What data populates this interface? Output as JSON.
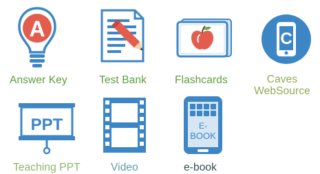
{
  "colors": {
    "icon_blue": "#3d86c6",
    "icon_blue_light": "#d6e6f3",
    "accent_red": "#e35d4f",
    "label_green": "#5f9c3e",
    "label_olive": "#8eab55",
    "label_teal": "#5d9fa6",
    "label_light_green": "#8ab46a",
    "label_dark": "#2f4f4f"
  },
  "resources": [
    {
      "label": "Answer Key",
      "icon": "lightbulb-a-icon",
      "icon_letter": "A"
    },
    {
      "label": "Test Bank",
      "icon": "document-pencil-icon"
    },
    {
      "label": "Flashcards",
      "icon": "apple-flashcard-icon"
    },
    {
      "label_line1": "Caves",
      "label_line2": "WebSource",
      "icon": "tablet-c-icon",
      "icon_letter": "C"
    },
    {
      "label": "Teaching PPT",
      "icon": "presentation-board-icon",
      "icon_text": "PPT"
    },
    {
      "label": "Video",
      "icon": "film-strip-icon"
    },
    {
      "label": "e-book",
      "icon": "ebook-reader-icon",
      "icon_text_line1": "E-",
      "icon_text_line2": "BOOK"
    }
  ]
}
